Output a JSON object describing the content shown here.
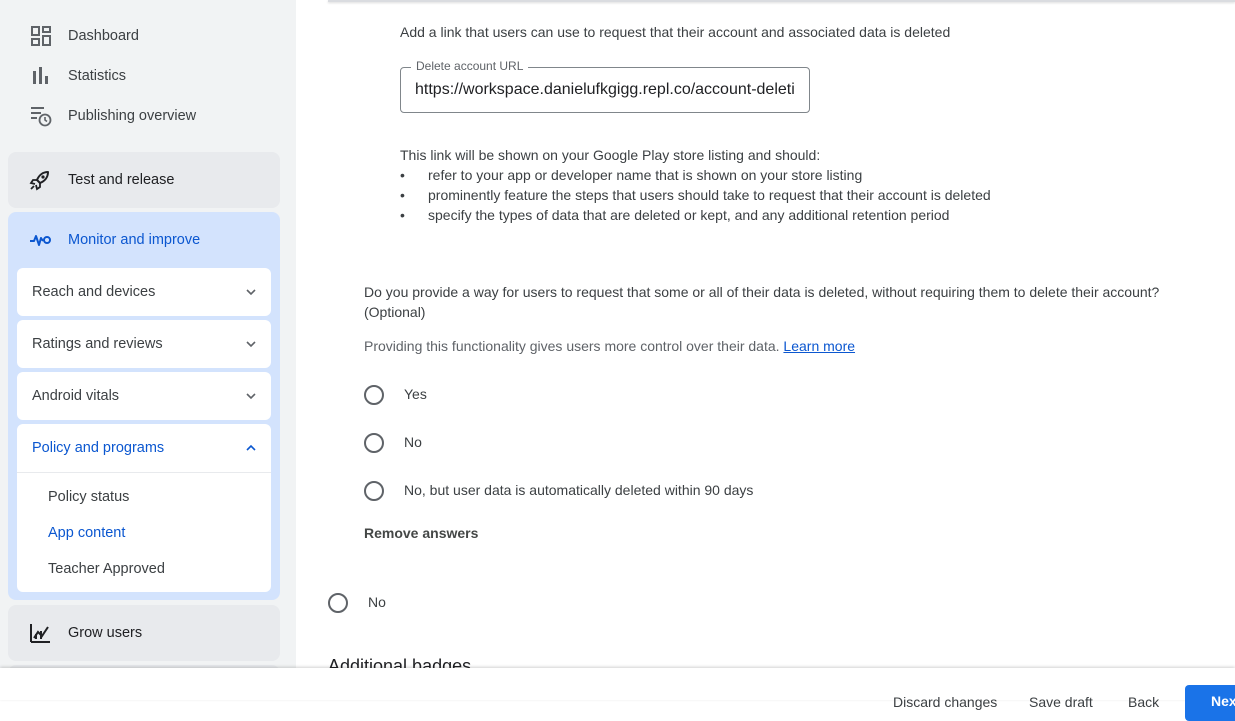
{
  "sidebar": {
    "dashboard": "Dashboard",
    "statistics": "Statistics",
    "publishing_overview": "Publishing overview",
    "test_and_release": "Test and release",
    "monitor_and_improve": "Monitor and improve",
    "reach_and_devices": "Reach and devices",
    "ratings_and_reviews": "Ratings and reviews",
    "android_vitals": "Android vitals",
    "policy_and_programs": "Policy and programs",
    "policy_items": [
      "Policy status",
      "App content",
      "Teacher Approved"
    ],
    "active_policy_item": "App content",
    "grow_users": "Grow users"
  },
  "main": {
    "delete_link_intro": "Add a link that users can use to request that their account and associated data is deleted",
    "delete_url_label": "Delete account URL",
    "delete_url_value": "https://workspace.danielufkgigg.repl.co/account-deletion",
    "link_info": "This link will be shown on your Google Play store listing and should:",
    "bullets": [
      "refer to your app or developer name that is shown on your store listing",
      "prominently feature the steps that users should take to request that their account is deleted",
      "specify the types of data that are deleted or kept, and any additional retention period"
    ],
    "question_line1": "Do you provide a way for users to request that some or all of their data is deleted, without requiring them to delete their account?",
    "question_line2": "(Optional)",
    "helper_text": "Providing this functionality gives users more control over their data.",
    "learn_more": "Learn more",
    "options": [
      "Yes",
      "No",
      "No, but user data is automatically deleted within 90 days"
    ],
    "remove_answers": "Remove answers",
    "outer_option": "No",
    "next_section_title": "Additional badges"
  },
  "bottom_bar": {
    "discard": "Discard changes",
    "save_draft": "Save draft",
    "back": "Back",
    "next": "Next"
  },
  "colors": {
    "accent": "#0b57d0",
    "sidebar_bg": "#f1f3f4",
    "active_group": "#d3e3fd"
  }
}
